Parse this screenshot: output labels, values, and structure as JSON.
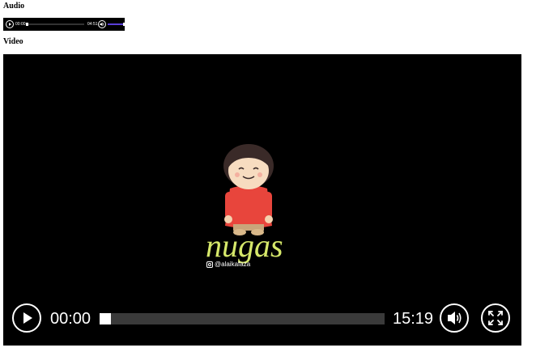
{
  "headings": {
    "audio": "Audio",
    "video": "Video"
  },
  "audio_player": {
    "current_time": "00:00",
    "duration": "04:51",
    "progress": 0,
    "volume": 1.0
  },
  "video_player": {
    "current_time": "00:00",
    "duration": "15:19",
    "progress": 0,
    "logo_text": "nugas",
    "social_handle": "@alaikafaza"
  },
  "colors": {
    "logo_green": "#d6e86a",
    "audio_volume": "#5a3fd8"
  }
}
